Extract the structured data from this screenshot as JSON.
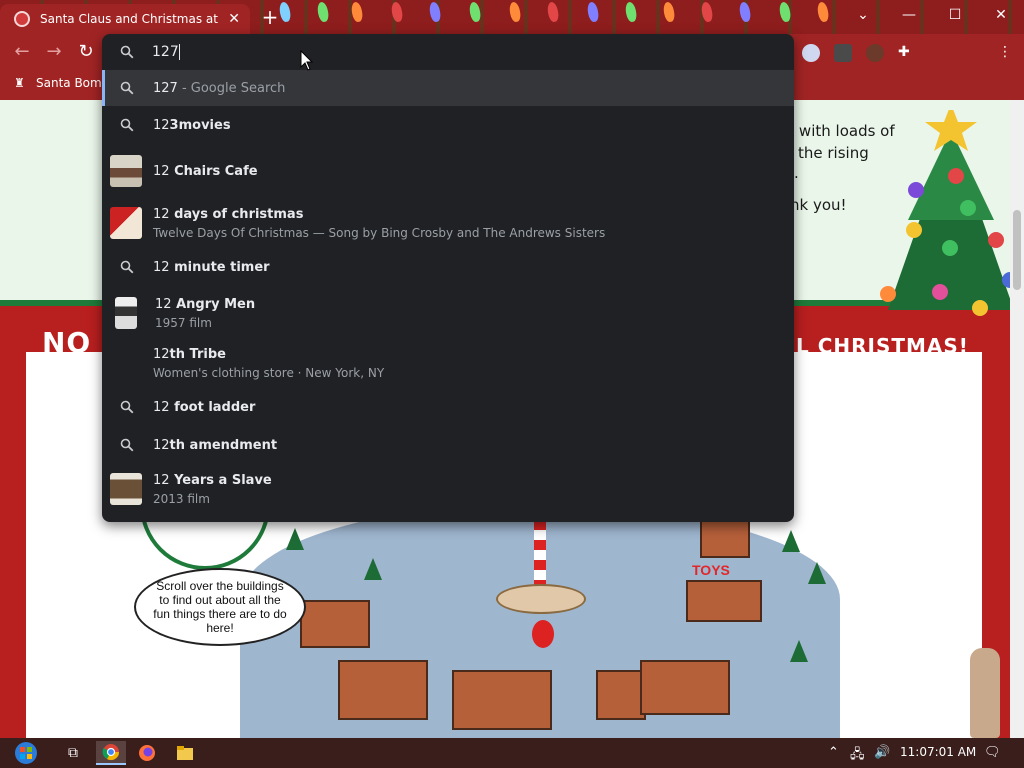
{
  "browser": {
    "tab_title": "Santa Claus and Christmas at the",
    "new_tab_symbol": "+",
    "bookmark_label": "Santa Bomb",
    "window_controls": [
      "chevron-down-icon",
      "minimize-icon",
      "maximize-icon",
      "close-icon"
    ]
  },
  "omnibox": {
    "query": "127",
    "suggestions": [
      {
        "match": "127",
        "rest": "",
        "suffix": " - Google Search",
        "sub": "",
        "icon": "search-icon"
      },
      {
        "match": "12",
        "rest": "3movies",
        "suffix": "",
        "sub": "",
        "icon": "search-icon"
      },
      {
        "match": "12",
        "rest": " Chairs Cafe",
        "suffix": "",
        "sub": "",
        "icon": "thumbnail"
      },
      {
        "match": "12",
        "rest": " days of christmas",
        "suffix": "",
        "sub": "Twelve Days Of Christmas — Song by Bing Crosby and The Andrews Sisters",
        "icon": "thumbnail"
      },
      {
        "match": "12",
        "rest": " minute timer",
        "suffix": "",
        "sub": "",
        "icon": "search-icon"
      },
      {
        "match": "12",
        "rest": " Angry Men",
        "suffix": "",
        "sub": "1957 film",
        "icon": "thumbnail"
      },
      {
        "match": "12",
        "rest": "th Tribe",
        "suffix": "",
        "sub": "Women's clothing store · New York, NY",
        "icon": "none"
      },
      {
        "match": "12",
        "rest": " foot ladder",
        "suffix": "",
        "sub": "",
        "icon": "search-icon"
      },
      {
        "match": "12",
        "rest": "th amendment",
        "suffix": "",
        "sub": "",
        "icon": "search-icon"
      },
      {
        "match": "12",
        "rest": " Years a Slave",
        "suffix": "",
        "sub": "2013 film",
        "icon": "thumbnail"
      }
    ]
  },
  "page": {
    "banner_lines": [
      "l with loads of",
      "the rising",
      ".",
      "nk you!"
    ],
    "headline_left": "NO",
    "headline_right": "L CHRISTMAS!",
    "speech_bubble": "Scroll over the buildings to find out about all the fun things there are to do here!",
    "toys_sign": "TOYS"
  },
  "taskbar": {
    "clock": "11:07:01 AM",
    "apps": [
      "start-button",
      "task-view-icon",
      "chrome-icon",
      "firefox-icon",
      "file-explorer-icon"
    ]
  },
  "colors": {
    "chrome_red": "#a12424",
    "omnibox_bg": "#202124",
    "omnibox_selected": "#35363a",
    "accent_blue": "#8ab4f8"
  }
}
